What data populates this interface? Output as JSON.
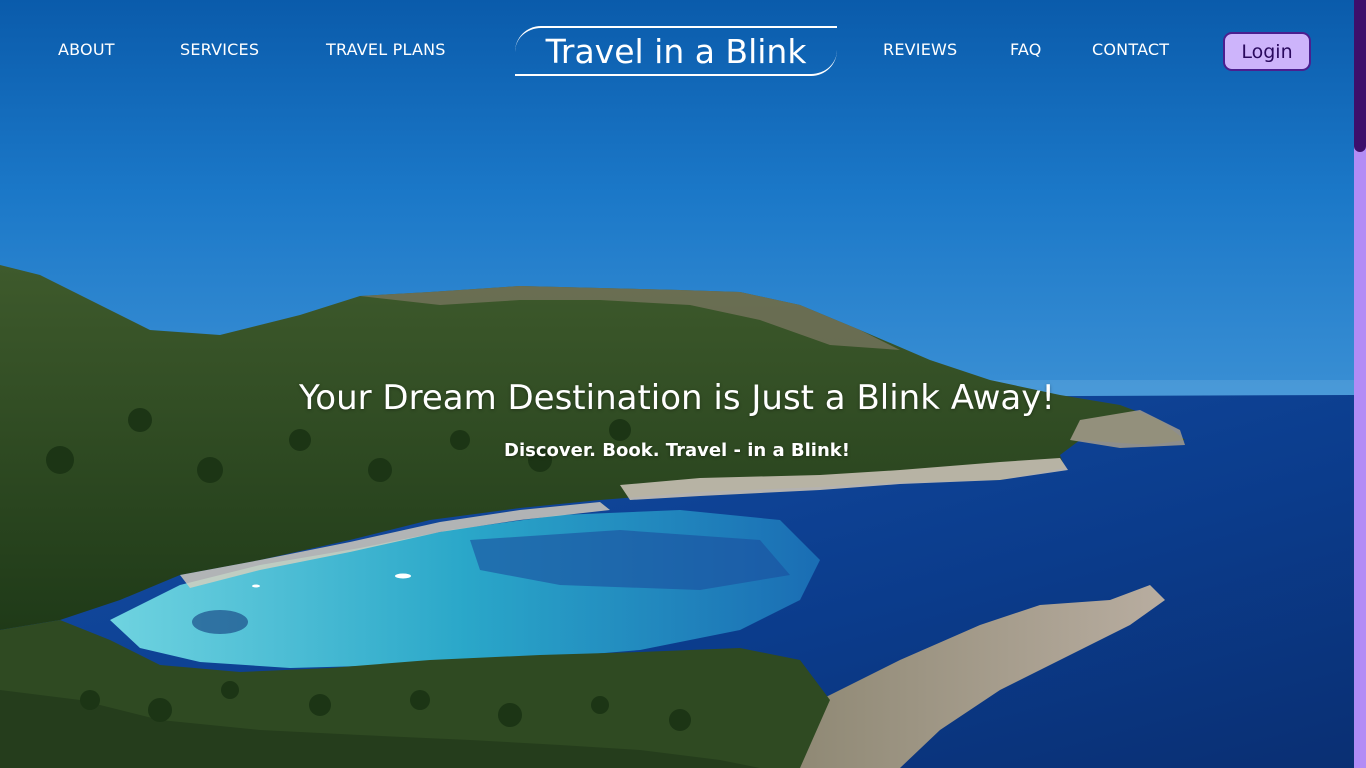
{
  "nav": {
    "left_links": [
      "ABOUT",
      "SERVICES",
      "TRAVEL PLANS"
    ],
    "brand": "Travel in a Blink",
    "right_links": [
      "REVIEWS",
      "FAQ",
      "CONTACT"
    ],
    "login_label": "Login"
  },
  "hero": {
    "headline": "Your Dream Destination is Just a Blink Away!",
    "tagline": "Discover. Book. Travel - in a Blink!",
    "background": "aerial coastal bay photo"
  },
  "colors": {
    "sky": "#0b5fae",
    "login_bg": "#cdb4fb",
    "login_border": "#4b1f8f",
    "scroll_track": "#b38cf5",
    "scroll_thumb": "#3d0f6b"
  }
}
